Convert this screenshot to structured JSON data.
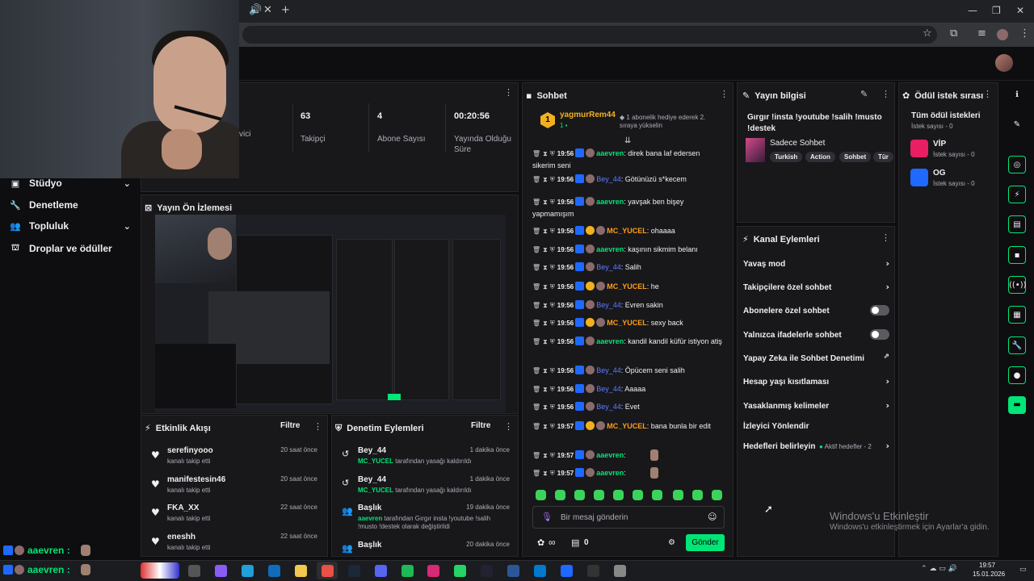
{
  "browser": {
    "tab_mute_icon": "speaker-icon",
    "tab_close": "✕",
    "new_tab": "+",
    "window_controls": [
      "—",
      "❐",
      "✕"
    ]
  },
  "sidebar": {
    "items": [
      {
        "label": "Stüdyo",
        "icon": "video-icon",
        "expandable": true
      },
      {
        "label": "Denetleme",
        "icon": "wrench-icon",
        "expandable": false
      },
      {
        "label": "Topluluk",
        "icon": "people-icon",
        "expandable": true
      },
      {
        "label": "Droplar ve ödüller",
        "icon": "gift-icon",
        "expandable": false
      }
    ]
  },
  "stats": {
    "partial_label": "vici",
    "items": [
      {
        "value": "63",
        "label": "Takipçi"
      },
      {
        "value": "4",
        "label": "Abone Sayısı"
      },
      {
        "value": "00:20:56",
        "label": "Yayında Olduğu Süre"
      }
    ]
  },
  "preview": {
    "title": "Yayın Ön İzlemesi"
  },
  "activity_feed": {
    "title": "Etkinlik Akışı",
    "filter": "Filtre",
    "items": [
      {
        "name": "serefinyooo",
        "sub": "kanalı takip etti",
        "time": "20 saat önce"
      },
      {
        "name": "manifestesin46",
        "sub": "kanalı takip etti",
        "time": "20 saat önce"
      },
      {
        "name": "FKA_XX",
        "sub": "kanalı takip etti",
        "time": "22 saat önce"
      },
      {
        "name": "eneshh",
        "sub": "kanalı takip etti",
        "time": "22 saat önce"
      }
    ]
  },
  "mod_actions": {
    "title": "Denetim Eylemleri",
    "filter": "Filtre",
    "items": [
      {
        "name": "Bey_44",
        "actor": "MC_YUCEL",
        "text": " tarafından yasağı kaldırıldı",
        "time": "1 dakika önce"
      },
      {
        "name": "Bey_44",
        "actor": "MC_YUCEL",
        "text": " tarafından yasağı kaldırıldı",
        "time": "1 dakika önce"
      },
      {
        "name": "Başlık",
        "actor": "aaevren",
        "text": " tarafından Gırgır insta !youtube !salih !musto !destek olarak değiştirildi",
        "time": "19 dakika önce"
      },
      {
        "name": "Başlık",
        "actor": "",
        "text": "",
        "time": "20 dakika önce"
      }
    ]
  },
  "chat": {
    "title": "Sohbet",
    "pinned": {
      "user": "yagmurRem44",
      "count": "1",
      "text": "1 abonelik hediye ederek 2. sıraya yükselin"
    },
    "messages": [
      {
        "time": "19:56",
        "user": "aaevren",
        "color": "green",
        "gold": false,
        "text": ": direk bana laf edersen sikerim seni"
      },
      {
        "time": "19:56",
        "user": "Bey_44",
        "color": "blue",
        "gold": false,
        "text": ": Götünüzü s*kecem"
      },
      {
        "time": "19:56",
        "user": "aaevren",
        "color": "green",
        "gold": false,
        "text": ": yavşak ben bişey yapmamışım"
      },
      {
        "time": "19:56",
        "user": "MC_YUCEL",
        "color": "orange",
        "gold": true,
        "text": ": ohaaaa"
      },
      {
        "time": "19:56",
        "user": "aaevren",
        "color": "green",
        "gold": false,
        "text": ": kaşının sikmim belanı"
      },
      {
        "time": "19:56",
        "user": "Bey_44",
        "color": "blue",
        "gold": false,
        "text": ": Salih"
      },
      {
        "time": "19:56",
        "user": "MC_YUCEL",
        "color": "orange",
        "gold": true,
        "text": ": he"
      },
      {
        "time": "19:56",
        "user": "Bey_44",
        "color": "blue",
        "gold": false,
        "text": ": Evren sakin"
      },
      {
        "time": "19:56",
        "user": "MC_YUCEL",
        "color": "orange",
        "gold": true,
        "text": ": sexy back"
      },
      {
        "time": "19:56",
        "user": "aaevren",
        "color": "green",
        "gold": false,
        "text": ": kandil kandil küfür istiyon atiş"
      },
      {
        "time": "19:56",
        "user": "Bey_44",
        "color": "blue",
        "gold": false,
        "text": ": Öpücem seni salih"
      },
      {
        "time": "19:56",
        "user": "Bey_44",
        "color": "blue",
        "gold": false,
        "text": ": Aaaaa"
      },
      {
        "time": "19:56",
        "user": "Bey_44",
        "color": "blue",
        "gold": false,
        "text": ": Evet"
      },
      {
        "time": "19:57",
        "user": "MC_YUCEL",
        "color": "orange",
        "gold": true,
        "text": ": bana bunla bir edit"
      },
      {
        "time": "19:57",
        "user": "aaevren",
        "color": "green",
        "gold": false,
        "text": ":"
      },
      {
        "time": "19:57",
        "user": "aaevren",
        "color": "green",
        "gold": false,
        "text": ":"
      }
    ],
    "input_placeholder": "Bir mesaj gönderin",
    "infinity": "∞",
    "points": "0",
    "send": "Gönder"
  },
  "stream_info": {
    "title": "Yayın bilgisi",
    "stream_title": "Gırgır !insta !youtube !salih !musto !destek",
    "category": "Sadece Sohbet",
    "tags": [
      "Turkish",
      "Action",
      "Sohbet",
      "Tür"
    ]
  },
  "channel_actions": {
    "title": "Kanal Eylemleri",
    "items": [
      {
        "label": "Yavaş mod",
        "control": "chevron"
      },
      {
        "label": "Takipçilere özel sohbet",
        "control": "chevron"
      },
      {
        "label": "Abonelere özel sohbet",
        "control": "toggle"
      },
      {
        "label": "Yalnızca ifadelerle sohbet",
        "control": "toggle"
      },
      {
        "label": "Yapay Zeka ile Sohbet Denetimi",
        "control": "external"
      },
      {
        "label": "Hesap yaşı kısıtlaması",
        "control": "chevron"
      },
      {
        "label": "Yasaklanmış kelimeler",
        "control": "chevron"
      },
      {
        "label": "İzleyici Yönlendir",
        "control": "none"
      },
      {
        "label": "Hedefleri belirleyin",
        "control": "chevron",
        "status": "Aktif hedefler - 2"
      }
    ]
  },
  "rewards": {
    "title": "Ödül istek sırası",
    "all_label": "Tüm ödül istekleri",
    "all_count": "İstek sayısı - 0",
    "items": [
      {
        "name": "VİP",
        "count": "İstek sayısı - 0",
        "color": "#e91e63"
      },
      {
        "name": "OG",
        "count": "İstek sayısı - 0",
        "color": "#1f69ff"
      }
    ]
  },
  "overlay_chat": {
    "user": "aaevren :",
    "user2": "aaevren :"
  },
  "watermark": {
    "line1": "Windows'u Etkinleştir",
    "line2": "Windows'u etkinleştirmek için Ayarlar'a gidin."
  },
  "taskbar": {
    "time": "19:57",
    "date": "15.01.2026"
  },
  "colors": {
    "accent": "#00e676",
    "panel": "#18181b",
    "bg": "#0e0e10"
  }
}
